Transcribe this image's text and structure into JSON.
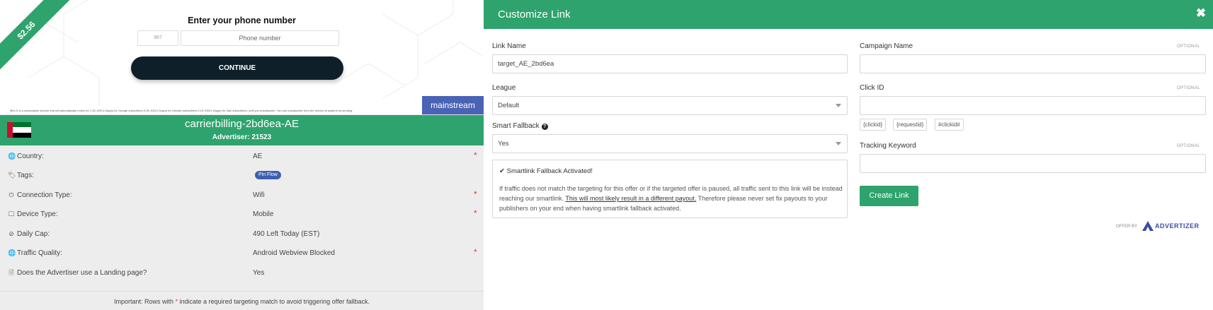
{
  "preview": {
    "payout": "$2.56",
    "title": "Enter your phone number",
    "country_code_placeholder": "967",
    "phone_placeholder": "Phone number",
    "continue_label": "CONTINUE",
    "tag": "mainstream",
    "fineprint": "Mini G is a subscription service that will automatically renew for 1.35 JOD/1 Day(s) for Orange subscribers 0.35 JOD/1 Day(s) for Umniah subscribers 0.15 JOD/1 Day(s) for Zain subscribers, until you unsubscribe. You can unsubscribe from the service at anytime by sending"
  },
  "offer": {
    "name": "carrierbilling-2bd6ea-AE",
    "advertiser": "Advertiser: 21523",
    "details": [
      {
        "icon": "globe-icon",
        "glyph": "🌐",
        "label": "Country:",
        "value": "AE",
        "required": true
      },
      {
        "icon": "tag-icon",
        "glyph": "🏷",
        "label": "Tags:",
        "value": "Pin Flow",
        "badge": true,
        "required": false
      },
      {
        "icon": "power-icon",
        "glyph": "⏻",
        "label": "Connection Type:",
        "value": "Wifi",
        "required": true
      },
      {
        "icon": "desktop-icon",
        "glyph": "🖵",
        "label": "Device Type:",
        "value": "Mobile",
        "required": true
      },
      {
        "icon": "ban-icon",
        "glyph": "⊘",
        "label": "Daily Cap:",
        "value": "490 Left Today (EST)",
        "required": false
      },
      {
        "icon": "globe-icon",
        "glyph": "🌐",
        "label": "Traffic Quality:",
        "value": "Android Webview Blocked",
        "required": true
      },
      {
        "icon": "file-icon",
        "glyph": "🗎",
        "label": "Does the Advertiser use a Landing page?",
        "value": "Yes",
        "required": false
      }
    ],
    "note_strong": "Important:",
    "note_pre": " Rows with ",
    "note_star": "*",
    "note_post": " indicate a required targeting match to avoid triggering offer fallback."
  },
  "modal": {
    "title": "Customize Link",
    "close_glyph": "✖",
    "link_name_label": "Link Name",
    "link_name_value": "target_AE_2bd6ea",
    "league_label": "League",
    "league_value": "Default",
    "smart_fallback_label": "Smart Fallback",
    "smart_fallback_value": "Yes",
    "fallback_title": "Smartlink Fallback Activated!",
    "fallback_text_1": "If traffic does not match the targeting for this offer or if the targeted offer is paused, all traffic sent to this link will be instead reaching our smartlink. ",
    "fallback_text_underline": "This will most likely result in a different payout.",
    "fallback_text_2": " Therefore please never set fix payouts to your publishers on your end when having smartlink fallback activated.",
    "campaign_name_label": "Campaign Name",
    "click_id_label": "Click ID",
    "tracking_keyword_label": "Tracking Keyword",
    "optional_label": "OPTIONAL",
    "macros": [
      "{clickid}",
      "{requestid}",
      "#clickid#"
    ],
    "create_link_label": "Create Link",
    "offer_by_label": "OFFER BY",
    "brand_name": "ADVERTIZER"
  },
  "colors": {
    "accent": "#2ea36d",
    "mainstream_tag": "#4a63b4",
    "required_star": "#e53935",
    "continue_button": "#0f1f2a"
  }
}
